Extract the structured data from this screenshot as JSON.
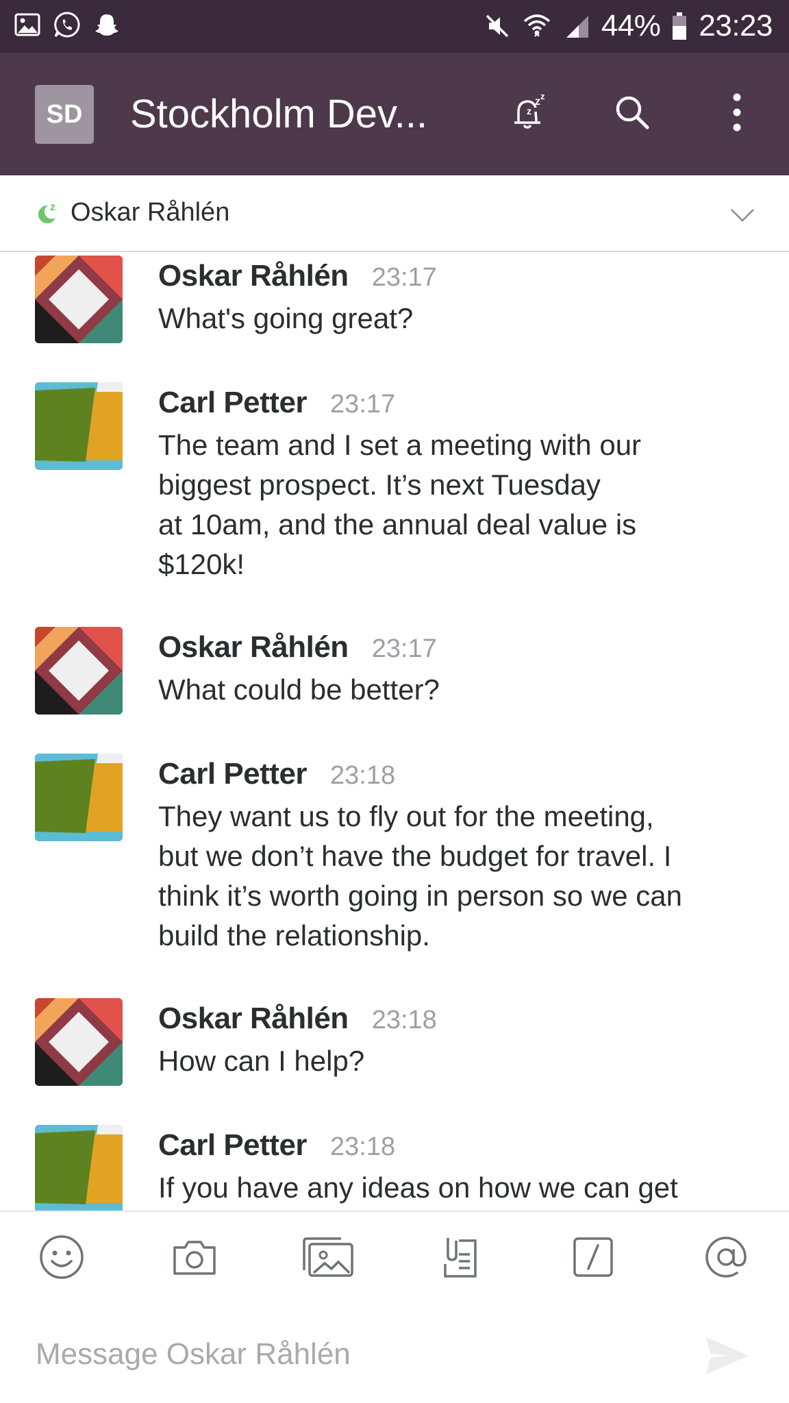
{
  "status_bar": {
    "battery": "44%",
    "time": "23:23",
    "left_icons": [
      "gallery-icon",
      "whatsapp-icon",
      "snapchat-icon"
    ],
    "right_icons": [
      "mute-icon",
      "wifi-icon",
      "signal-icon",
      "battery-icon"
    ]
  },
  "header": {
    "team_initials": "SD",
    "team_name": "Stockholm Dev...",
    "actions": [
      "snooze-bell-icon",
      "search-icon",
      "overflow-menu-icon"
    ]
  },
  "channel": {
    "name": "Oskar Råhlén",
    "presence": "snoozed"
  },
  "messages": [
    {
      "sender": "Oskar Råhlén",
      "time": "23:17",
      "text": "What's going great?",
      "avatar": "oskar"
    },
    {
      "sender": "Carl Petter",
      "time": "23:17",
      "lines": [
        "The team and I set a meeting with our",
        "biggest prospect. It’s next Tuesday",
        "at 10am, and the annual deal value is",
        "$120k!"
      ],
      "avatar": "carl"
    },
    {
      "sender": "Oskar Råhlén",
      "time": "23:17",
      "text": "What could be better?",
      "avatar": "oskar"
    },
    {
      "sender": "Carl Petter",
      "time": "23:18",
      "lines": [
        "They want us to fly out for the meeting,",
        "but we don’t have the budget for travel. I",
        "think it’s worth going in person so we can",
        "build the relationship."
      ],
      "avatar": "carl"
    },
    {
      "sender": "Oskar Råhlén",
      "time": "23:18",
      "text": "How can I help?",
      "avatar": "oskar"
    },
    {
      "sender": "Carl Petter",
      "time": "23:18",
      "text": "If you have any ideas on how we can get",
      "avatar": "carl"
    }
  ],
  "toolbar": {
    "items": [
      "emoji-icon",
      "camera-icon",
      "photo-gallery-icon",
      "file-icon",
      "slash-command-icon",
      "mention-icon"
    ]
  },
  "composer": {
    "placeholder": "Message Oskar Råhlén",
    "value": ""
  },
  "colors": {
    "status_bar": "#3b2a3b",
    "header": "#4d394b",
    "presence": "#6bc76b"
  }
}
